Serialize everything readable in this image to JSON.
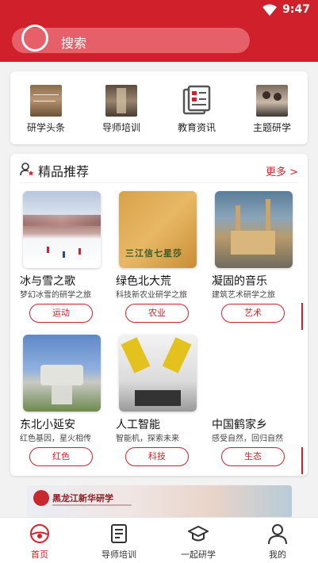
{
  "status_bar": {
    "time": "9:47",
    "icons": [
      "wifi-icon"
    ]
  },
  "search": {
    "placeholder": "搜索"
  },
  "quick_nav": [
    {
      "label": "研学头条",
      "thumb_text": "Make\nHeadlines"
    },
    {
      "label": "导师培训",
      "thumb_text": "Innovation\nCollege"
    },
    {
      "label": "教育资讯",
      "thumb_text": ""
    },
    {
      "label": "主题研学",
      "thumb_text": "Activity\nMatch"
    }
  ],
  "recommend": {
    "title": "精品推荐",
    "more": "更多 >",
    "items": [
      {
        "name": "冰与雪之歌",
        "desc": "梦幻冰雪的研学之旅",
        "tag": "运动",
        "image": "snow-resort"
      },
      {
        "name": "绿色北大荒",
        "desc": "科技新农业研学之旅",
        "tag": "农业",
        "image": "field-text",
        "image_text": "三江信七星莎"
      },
      {
        "name": "凝固的音乐",
        "desc": "建筑艺术研学之旅",
        "tag": "艺术",
        "image": "church"
      },
      {
        "name": "东北小延安",
        "desc": "红色基因，星火相传",
        "tag": "红色",
        "image": "monument"
      },
      {
        "name": "人工智能",
        "desc": "智能机，探索未来",
        "tag": "科技",
        "image": "robot-arms"
      },
      {
        "name": "中国鹤家乡",
        "desc": "感受自然，回归自然",
        "tag": "生态",
        "image": ""
      }
    ]
  },
  "banner": {
    "title": "黑龙江新华研学",
    "icon": "seal-logo"
  },
  "tabs": [
    {
      "label": "首页",
      "icon": "home-icon",
      "active": true
    },
    {
      "label": "导师培训",
      "icon": "document-icon",
      "active": false
    },
    {
      "label": "一起研学",
      "icon": "graduation-cap-icon",
      "active": false
    },
    {
      "label": "我的",
      "icon": "user-icon",
      "active": false
    }
  ],
  "colors": {
    "brand": "#d0202b",
    "background": "#f2f2f2"
  }
}
